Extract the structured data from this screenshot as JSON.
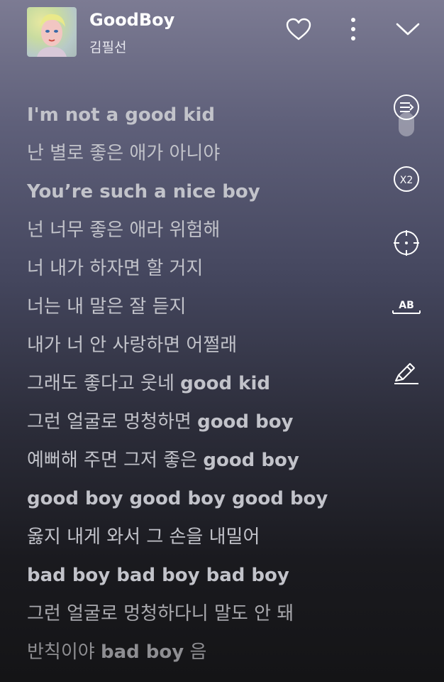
{
  "track": {
    "title": "GoodBoy",
    "artist": "김필선"
  },
  "header_icons": [
    "heart-icon",
    "more-vertical-icon",
    "chevron-down-icon"
  ],
  "tools": [
    {
      "name": "scroll-lyrics-toggle-icon"
    },
    {
      "name": "speed-x2-icon",
      "label": "X2"
    },
    {
      "name": "target-icon"
    },
    {
      "name": "translate-ab-icon",
      "label": "AB"
    },
    {
      "name": "highlighter-icon"
    }
  ],
  "lyrics": [
    "I'm not a good kid",
    "난 별로 좋은 애가 아니야",
    "You’re such a nice boy",
    "넌 너무 좋은 애라 위험해",
    "너 내가 하자면 할 거지",
    "너는 내 말은 잘 듣지",
    "내가 너 안 사랑하면 어쩔래",
    {
      "ko": "그래도 좋다고 웃네 ",
      "en": "good kid"
    },
    {
      "ko": "그런 얼굴로 멍청하면 ",
      "en": "good boy"
    },
    {
      "ko": "예뻐해 주면 그저 좋은 ",
      "en": "good boy"
    },
    "good boy good boy good boy",
    "옳지 내게 와서 그 손을 내밀어",
    "bad boy bad boy bad boy",
    "그런 얼굴로 멍청하다니 말도 안 돼",
    {
      "ko": "반칙이야 ",
      "en": "bad boy",
      "tail": " 음"
    }
  ]
}
